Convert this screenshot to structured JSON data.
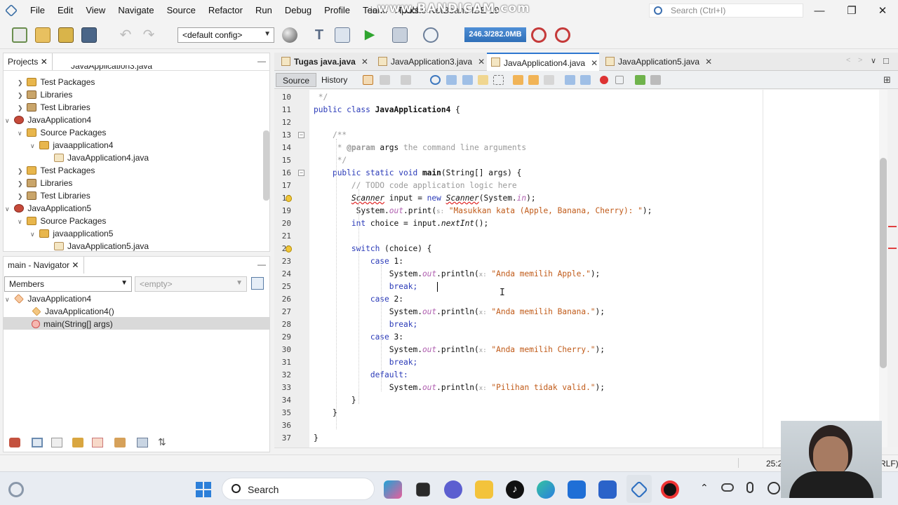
{
  "window": {
    "title": "ion4 - Apache NetBeans IDE 19",
    "watermark": "www.BANDICAM.com",
    "search_placeholder": "Search (Ctrl+I)"
  },
  "menu": [
    "File",
    "Edit",
    "View",
    "Navigate",
    "Source",
    "Refactor",
    "Run",
    "Debug",
    "Profile",
    "Team",
    "Tools"
  ],
  "toolbar": {
    "config": "<default config>",
    "memory": "246.3/282.0MB"
  },
  "projects": {
    "tab": "Projects",
    "clipped_top": "JavaApplication3.java",
    "rows": [
      {
        "label": "Test Packages",
        "icon": "package-icon"
      },
      {
        "label": "Libraries",
        "icon": "library-icon"
      },
      {
        "label": "Test Libraries",
        "icon": "library-icon"
      },
      {
        "label": "JavaApplication4",
        "icon": "project-icon"
      },
      {
        "label": "Source Packages",
        "icon": "package-icon"
      },
      {
        "label": "javaapplication4",
        "icon": "package-icon"
      },
      {
        "label": "JavaApplication4.java",
        "icon": "java-file-icon"
      },
      {
        "label": "Test Packages",
        "icon": "package-icon"
      },
      {
        "label": "Libraries",
        "icon": "library-icon"
      },
      {
        "label": "Test Libraries",
        "icon": "library-icon"
      },
      {
        "label": "JavaApplication5",
        "icon": "project-icon"
      },
      {
        "label": "Source Packages",
        "icon": "package-icon"
      },
      {
        "label": "javaapplication5",
        "icon": "package-icon"
      },
      {
        "label": "JavaApplication5.java",
        "icon": "java-file-icon"
      }
    ]
  },
  "navigator": {
    "tab": "main - Navigator",
    "filter": "Members",
    "empty": "<empty>",
    "rows": [
      {
        "label": "JavaApplication4",
        "icon": "class-icon"
      },
      {
        "label": "JavaApplication4()",
        "icon": "constructor-icon"
      },
      {
        "label": "main(String[] args)",
        "icon": "method-icon"
      }
    ]
  },
  "editor": {
    "tabs": [
      {
        "label": "Tugas java.java",
        "bold": true
      },
      {
        "label": "JavaApplication3.java"
      },
      {
        "label": "JavaApplication4.java",
        "active": true
      },
      {
        "label": "JavaApplication5.java"
      }
    ],
    "source_label": "Source",
    "history_label": "History",
    "line_numbers": [
      "10",
      "11",
      "12",
      "13",
      "14",
      "15",
      "16",
      "17",
      "18",
      "19",
      "20",
      "21",
      "22",
      "23",
      "24",
      "25",
      "26",
      "27",
      "28",
      "29",
      "30",
      "31",
      "32",
      "33",
      "34",
      "35",
      "36",
      "37"
    ],
    "code": {
      "l10": " */",
      "l11_kw": "public class ",
      "l11_name": "JavaApplication4",
      "l11_end": " {",
      "l13": "/**",
      "l14_a": " * ",
      "l14_b": "@param",
      "l14_c": " args ",
      "l14_d": "the command line arguments",
      "l15": " */",
      "l16_kw": "public static void ",
      "l16_name": "main",
      "l16_end": "(String[] args) {",
      "l17": "// TODO code application logic here",
      "l18_a": "Scanner",
      "l18_b": " input = ",
      "l18_c": "new ",
      "l18_d": "Scanner",
      "l18_e": "(System.",
      "l18_f": "in",
      "l18_g": ");",
      "l19_a": "System.",
      "l19_b": "out",
      "l19_c": ".print(",
      "l19_h": "s:",
      "l19_d": " \"Masukkan kata (Apple, Banana, Cherry): \"",
      "l19_e": ");",
      "l20_a": "int",
      "l20_b": " choice = input.",
      "l20_c": "nextInt",
      "l20_d": "();",
      "l22_a": "switch",
      "l22_b": " (choice) {",
      "l23_a": "case",
      "l23_b": " 1:",
      "l24_str": " \"Anda memilih Apple.\"",
      "l25": "break;",
      "l26_b": " 2:",
      "l27_str": " \"Anda memilih Banana.\"",
      "l28": "break;",
      "l29_b": " 3:",
      "l30_str": " \"Anda memilih Cherry.\"",
      "l31": "break;",
      "l32": "default:",
      "l33_str": " \"Pilihan tidak valid.\"",
      "l34": "}",
      "l35": "}",
      "l37": "}",
      "sys": "System.",
      "out": "out",
      "println": ".println(",
      "xhint": "x:",
      "close": ");",
      "case": "case"
    }
  },
  "status": {
    "position": "25:2",
    "eol": "RLF)"
  },
  "taskbar": {
    "search": "Search"
  }
}
